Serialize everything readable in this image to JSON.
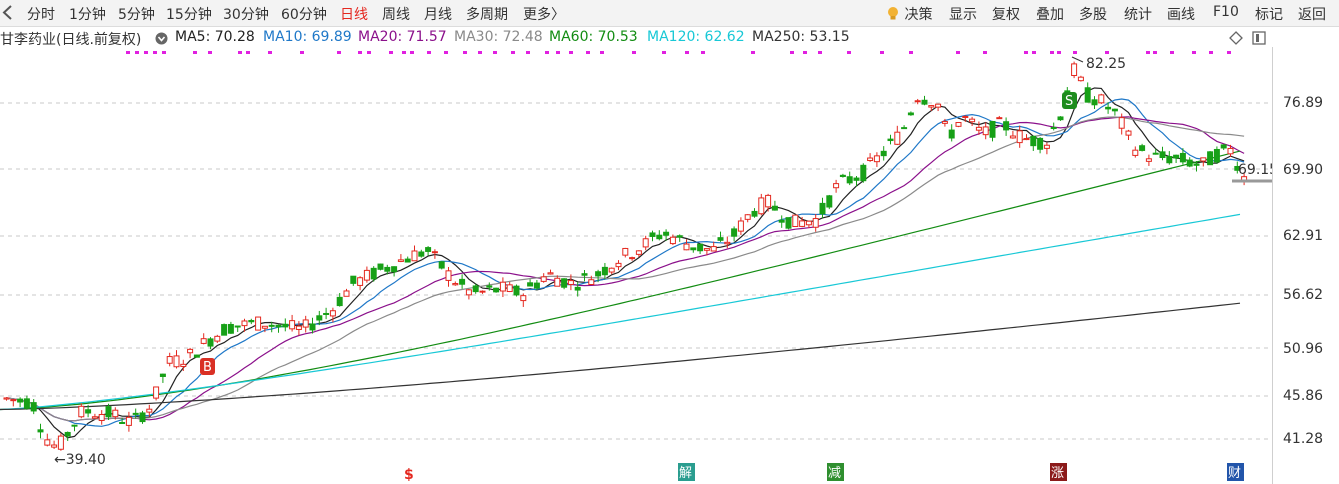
{
  "toolbar": {
    "periods": [
      "分时",
      "1分钟",
      "5分钟",
      "15分钟",
      "30分钟",
      "60分钟",
      "日线",
      "周线",
      "月线",
      "多周期",
      "更多〉"
    ],
    "active_period": "日线",
    "decision": "决策",
    "tools": [
      "显示",
      "复权",
      "叠加",
      "多股",
      "统计",
      "画线",
      "F10",
      "标记",
      "返回"
    ]
  },
  "legend": {
    "title": "甘李药业(日线.前复权)",
    "ma": [
      {
        "label": "MA5: 70.28",
        "color": "#222222"
      },
      {
        "label": "MA10: 69.89",
        "color": "#1f78c8"
      },
      {
        "label": "MA20: 71.57",
        "color": "#8b108b"
      },
      {
        "label": "MA30: 72.48",
        "color": "#8a8a8a"
      },
      {
        "label": "MA60: 70.53",
        "color": "#128c12"
      },
      {
        "label": "MA120: 62.62",
        "color": "#18c8d6"
      },
      {
        "label": "MA250: 53.15",
        "color": "#333333"
      }
    ]
  },
  "yaxis": {
    "labels": [
      "76.89",
      "69.90",
      "62.91",
      "56.62",
      "50.96",
      "45.86",
      "41.28"
    ],
    "price_tag": "69.15"
  },
  "annotations": {
    "high": "82.25",
    "low": "←39.40",
    "buy": "B",
    "sell": "S",
    "markers": [
      {
        "text": "$",
        "color": "#e4281f",
        "bg": ""
      },
      {
        "text": "解",
        "color": "#ffffff",
        "bg": "#2a9d8f"
      },
      {
        "text": "减",
        "color": "#ffffff",
        "bg": "#2f8f2f"
      },
      {
        "text": "涨",
        "color": "#ffffff",
        "bg": "#8b1a1a"
      },
      {
        "text": "财",
        "color": "#ffffff",
        "bg": "#2255aa"
      }
    ]
  },
  "colors": {
    "up": "#e4281f",
    "down": "#17a017",
    "grid": "#c8c8c8",
    "dots": "#e020e0"
  }
}
